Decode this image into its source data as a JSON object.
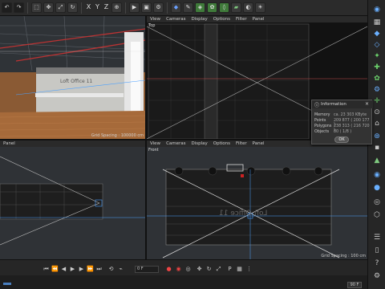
{
  "viewports": {
    "topright": {
      "name": "Top",
      "menu": [
        "View",
        "Cameras",
        "Display",
        "Options",
        "Filter",
        "Panel"
      ]
    },
    "bottomleft": {
      "name": "Panel",
      "grid": "Grid Spacing : 100 cm"
    },
    "bottomright": {
      "name": "Front",
      "menu": [
        "View",
        "Cameras",
        "Display",
        "Options",
        "Filter",
        "Panel"
      ],
      "grid": "Grid Spacing : 100 cm"
    },
    "topleft": {
      "grid": "Grid Spacing : 100000 cm",
      "office_sign": "Loft Office 11"
    },
    "front_sign": "Loft Office 11"
  },
  "toolbar": {
    "axes": [
      "X",
      "Y",
      "Z"
    ]
  },
  "info": {
    "title": "Information",
    "rows": [
      {
        "label": "Memory",
        "value": "ca. 23 303 KByte"
      },
      {
        "label": "Points",
        "value": "209 877 ( 200 177 )"
      },
      {
        "label": "Polygons",
        "value": "238 313 ( 216 720 )"
      },
      {
        "label": "Objects",
        "value": "80 ( 1/8 )"
      }
    ],
    "ok": "OK"
  },
  "timeline": {
    "frame": "0 F",
    "end": "90 F"
  }
}
